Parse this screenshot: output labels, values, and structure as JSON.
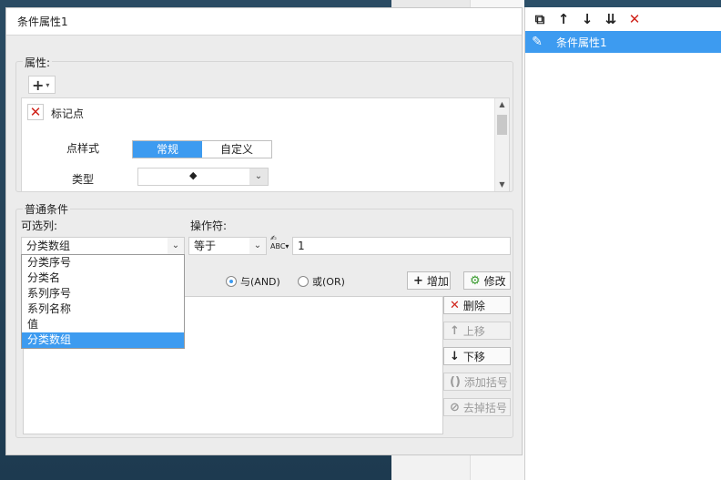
{
  "dialog": {
    "title": "条件属性1",
    "properties": {
      "label": "属性:",
      "add_icon": "plus-icon",
      "marker": {
        "label": "标记点",
        "point_style_label": "点样式",
        "point_style_options": [
          "常规",
          "自定义"
        ],
        "point_style_selected": "常规",
        "type_label": "类型",
        "type_value": "◆"
      }
    },
    "conditions": {
      "label": "普通条件",
      "column_label": "可选列:",
      "column_value": "分类数组",
      "column_options": [
        "分类序号",
        "分类名",
        "系列序号",
        "系列名称",
        "值",
        "分类数组"
      ],
      "column_selected": "分类数组",
      "operator_label": "操作符:",
      "operator_value": "等于",
      "value": "1",
      "and_label": "与(AND)",
      "or_label": "或(OR)",
      "add_label": "增加",
      "modify_label": "修改",
      "delete_label": "删除",
      "move_up_label": "上移",
      "move_down_label": "下移",
      "add_bracket_label": "添加括号",
      "remove_bracket_label": "去掉括号"
    }
  },
  "right_panel": {
    "items": [
      "条件属性1"
    ]
  }
}
